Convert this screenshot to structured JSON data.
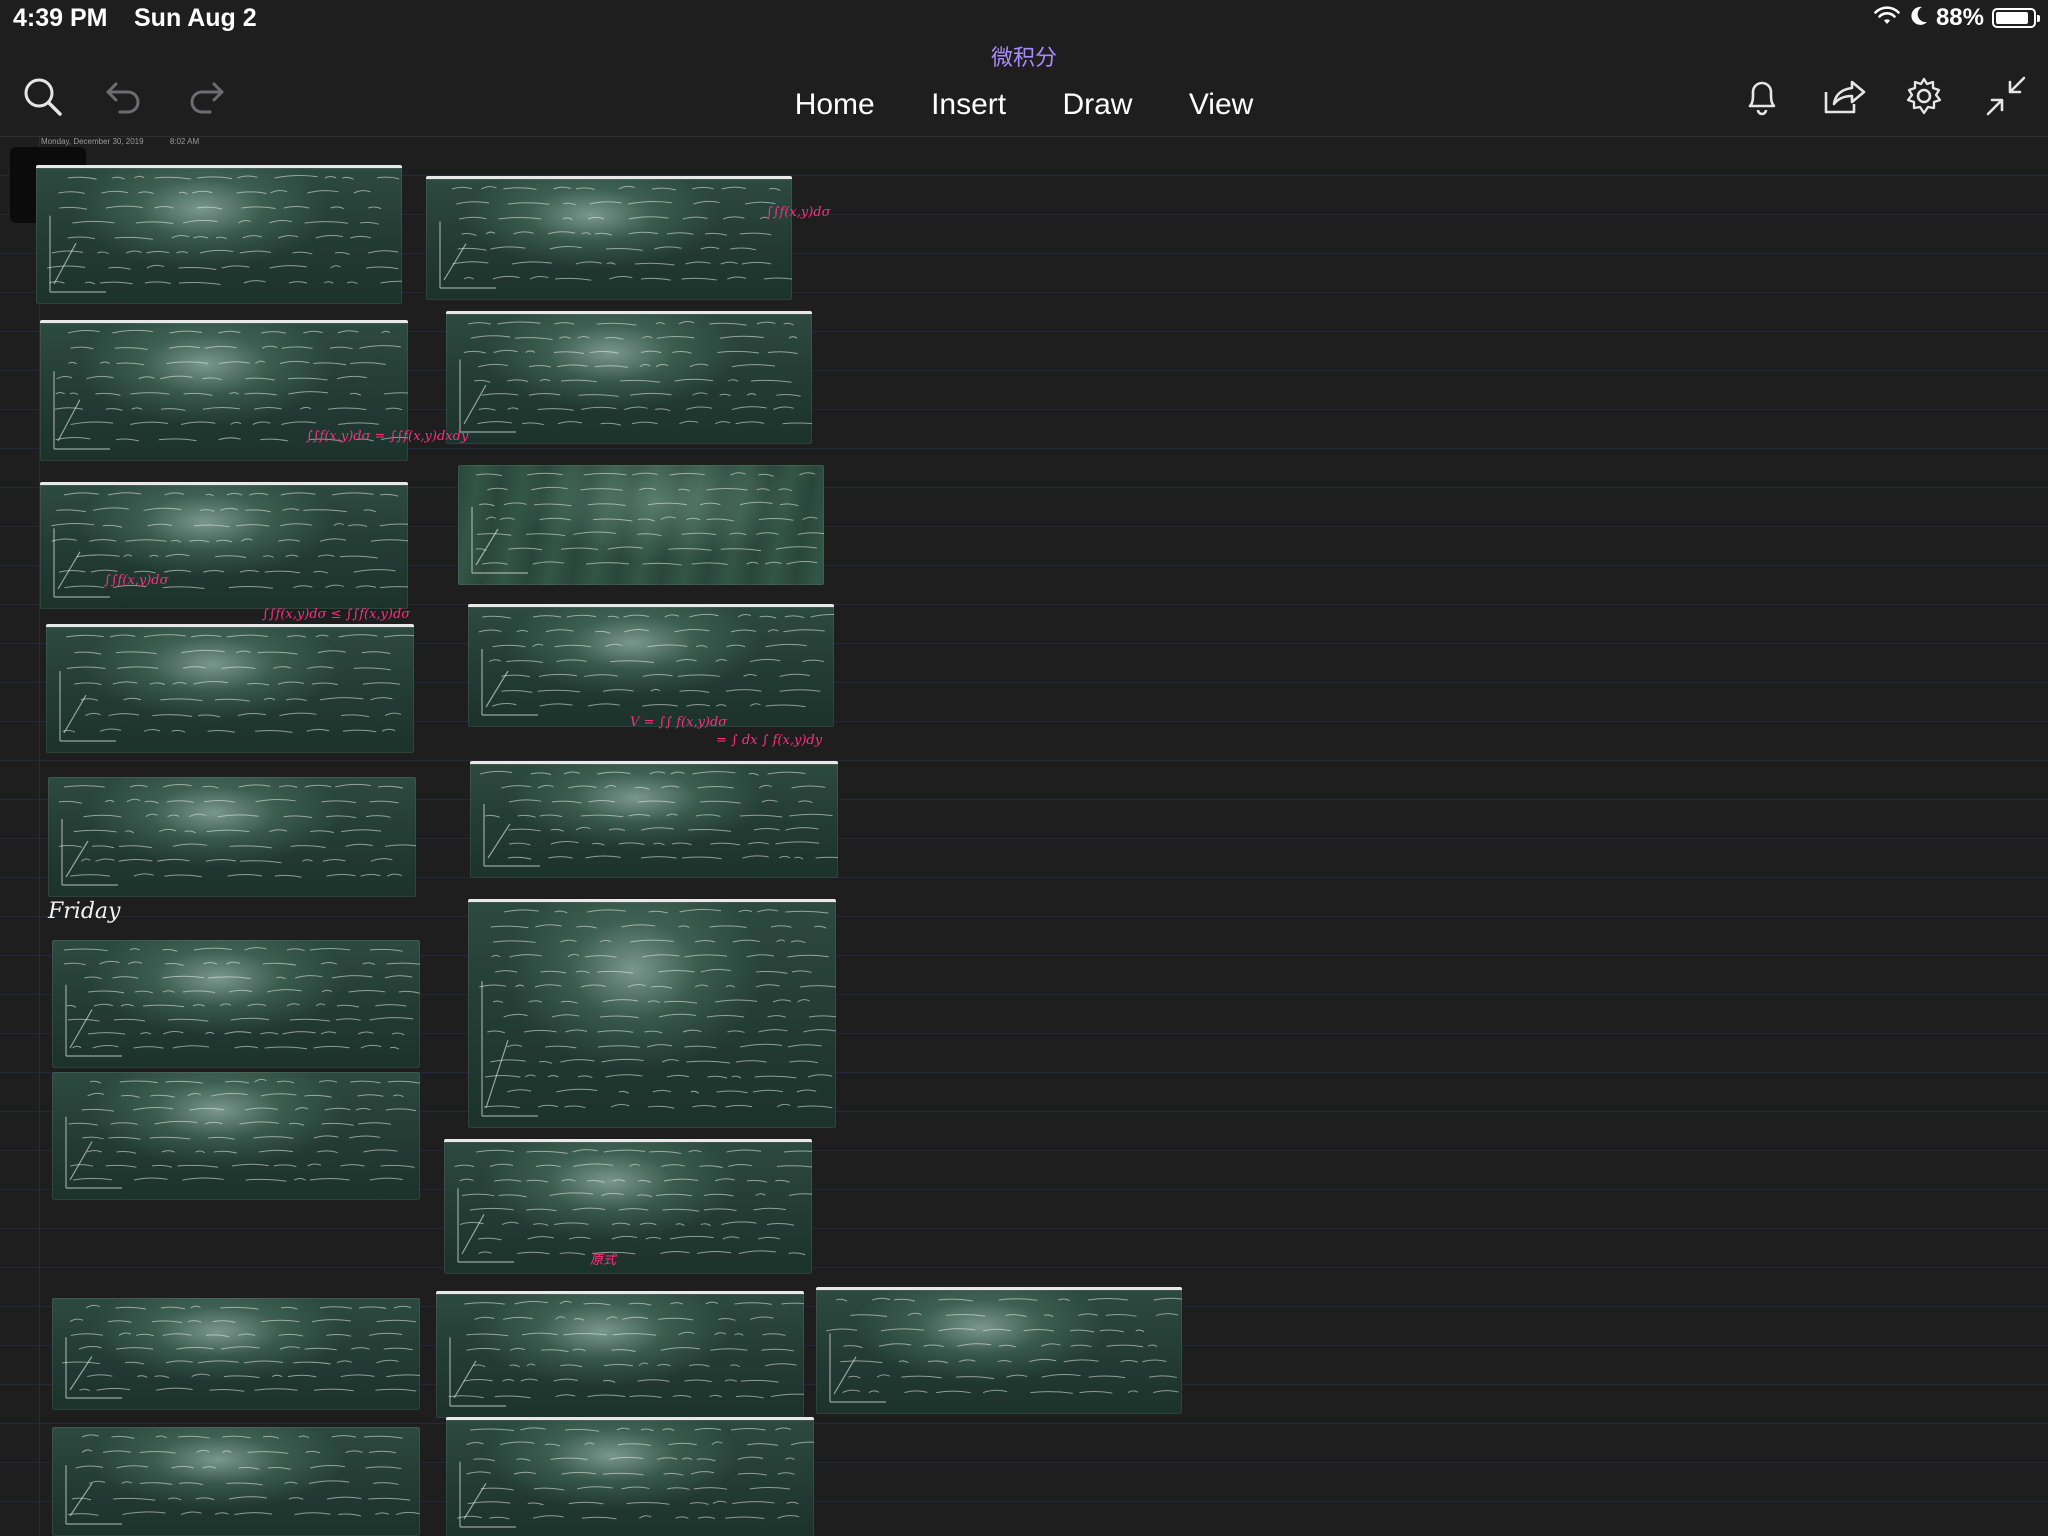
{
  "status_bar": {
    "time": "4:39 PM",
    "date": "Sun Aug 2",
    "battery": "88%",
    "battery_level": 0.88,
    "icons": [
      "wifi-icon",
      "moon-icon",
      "battery-icon"
    ]
  },
  "document": {
    "title": "微积分"
  },
  "toolbar": {
    "tabs": [
      "Home",
      "Insert",
      "Draw",
      "View"
    ],
    "left_icons": [
      "search-icon",
      "undo-icon",
      "redo-icon"
    ],
    "right_icons": [
      "bell-icon",
      "share-icon",
      "gear-icon",
      "collapse-icon"
    ]
  },
  "page": {
    "date": "Monday, December 30, 2019",
    "time": "8:02 AM",
    "handwritten_label": "Friday",
    "annotations": [
      "∫∫f(x,y)dσ",
      "∫∫f(x,y)dσ = ∫∫f(x,y)dxdy",
      "∫∫f(x,y)dσ",
      "∫∫f(x,y)dσ ≤ ∫∫f(x,y)dσ",
      "V = ∫∫ f(x,y)dσ",
      "= ∫ dx ∫ f(x,y)dy",
      "原式"
    ]
  },
  "colors": {
    "background": "#1e1e1f",
    "accent": "#a78bfa",
    "ink": "#ff2e7e",
    "chalkboard": "#2a463c"
  }
}
